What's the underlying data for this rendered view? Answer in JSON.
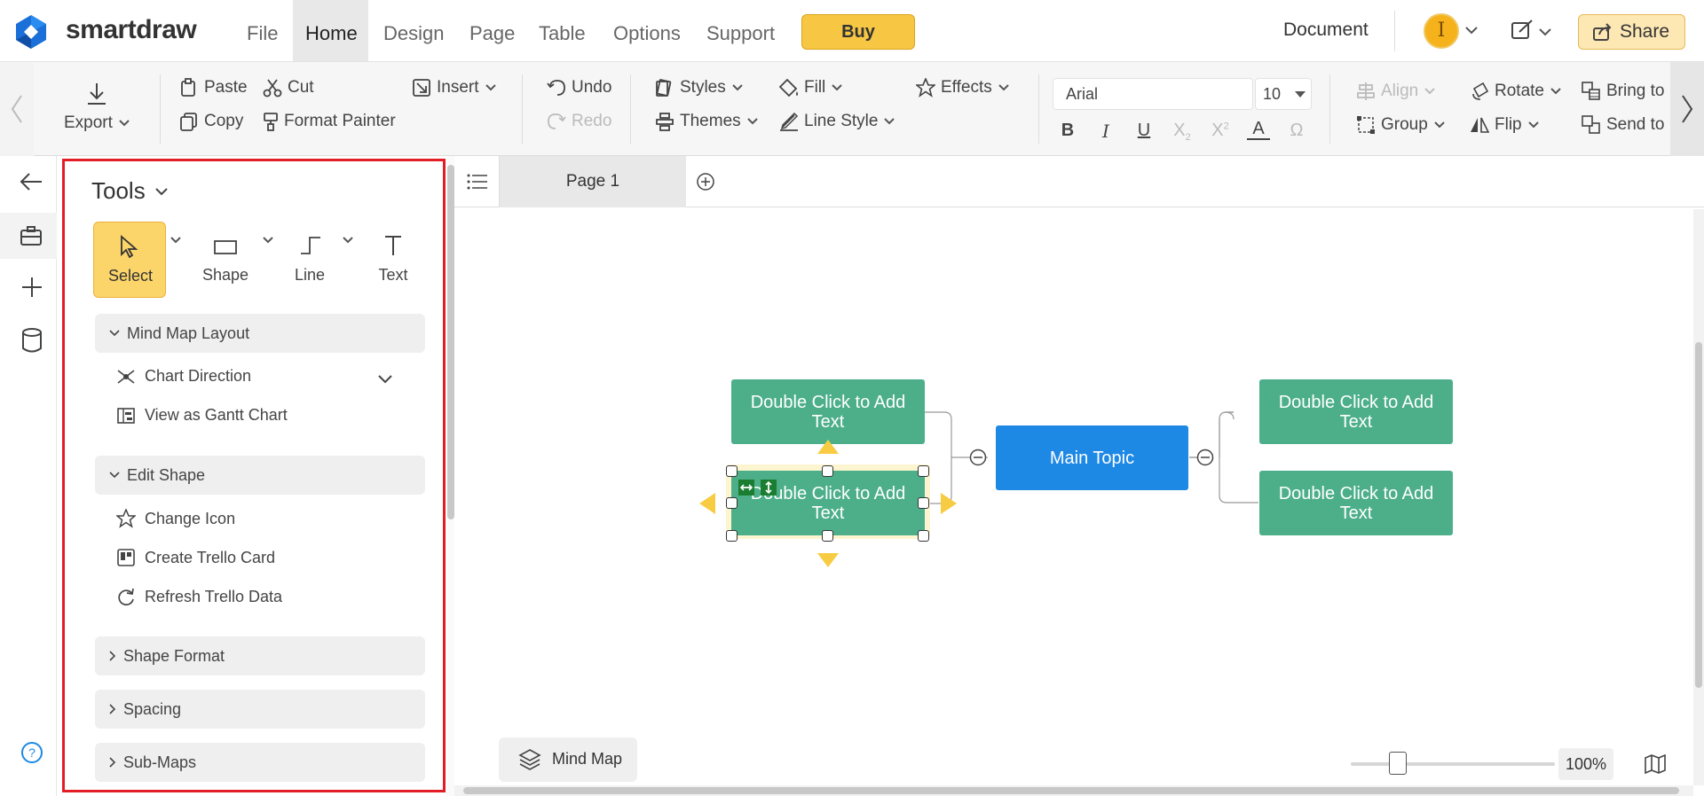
{
  "app": {
    "brand": "smartdraw",
    "document_label": "Document",
    "avatar_initial": "I"
  },
  "menu": {
    "items": [
      "File",
      "Home",
      "Design",
      "Page",
      "Table",
      "Options",
      "Support"
    ],
    "buy": "Buy",
    "share": "Share"
  },
  "ribbon": {
    "export": "Export",
    "paste": "Paste",
    "cut": "Cut",
    "copy": "Copy",
    "format_painter": "Format Painter",
    "insert": "Insert",
    "undo": "Undo",
    "redo": "Redo",
    "styles": "Styles",
    "themes": "Themes",
    "fill": "Fill",
    "line_style": "Line Style",
    "effects": "Effects",
    "font_family": "Arial",
    "font_size": "10",
    "align": "Align",
    "group": "Group",
    "rotate": "Rotate",
    "flip": "Flip",
    "bring_to": "Bring to",
    "send_to": "Send to"
  },
  "tools_panel": {
    "title": "Tools",
    "tools": [
      "Select",
      "Shape",
      "Line",
      "Text"
    ],
    "mind_map_layout": {
      "label": "Mind Map Layout",
      "items": [
        "Chart Direction",
        "View as Gantt Chart"
      ]
    },
    "edit_shape": {
      "label": "Edit Shape",
      "items": [
        "Change Icon",
        "Create Trello Card",
        "Refresh Trello Data"
      ]
    },
    "shape_format": "Shape Format",
    "spacing": "Spacing",
    "sub_maps": "Sub-Maps"
  },
  "page_tabs": {
    "current": "Page 1"
  },
  "canvas": {
    "main_topic": "Main Topic",
    "nodes": [
      "Double Click to Add Text",
      "Double Click to Add Text",
      "Double Click to Add Text",
      "Double Click to Add Text"
    ],
    "mind_map_button": "Mind Map",
    "zoom": "100%",
    "zoom_level": 0.23
  },
  "colors": {
    "accent_buy": "#f7c743",
    "node_green": "#4caf8a",
    "main_topic_blue": "#1e88e5",
    "highlight_red": "#e21d25"
  }
}
